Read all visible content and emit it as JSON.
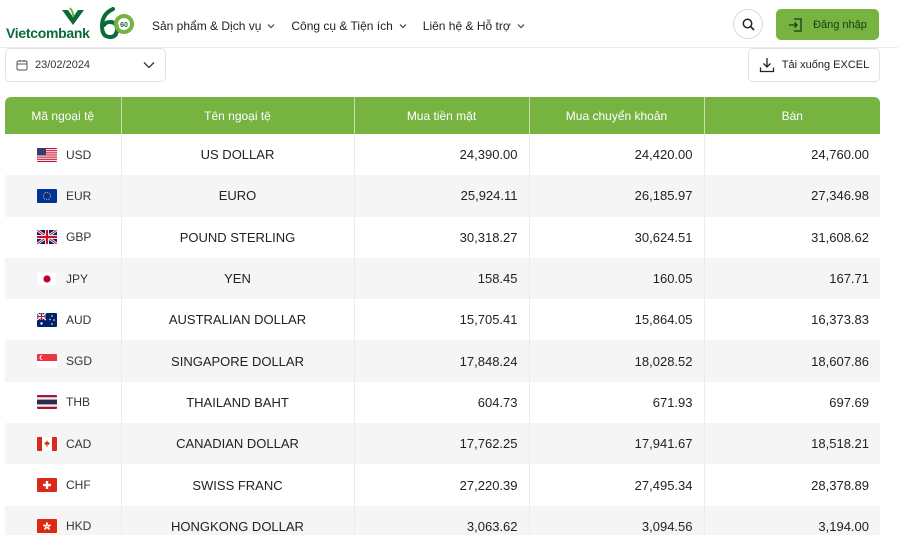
{
  "brand": {
    "name": "Vietcombank",
    "anniversary": "60"
  },
  "nav": [
    {
      "label": "Sản phẩm & Dịch vụ"
    },
    {
      "label": "Công cụ & Tiện ích"
    },
    {
      "label": "Liên hệ & Hỗ trợ"
    }
  ],
  "header": {
    "login_label": "Đăng nhập"
  },
  "toolbar": {
    "date_value": "23/02/2024",
    "excel_label": "Tải xuống EXCEL"
  },
  "colors": {
    "accent": "#77b341",
    "brand_green": "#0b6b3a"
  },
  "table": {
    "headers": [
      "Mã ngoại tệ",
      "Tên ngoại tệ",
      "Mua tiền mặt",
      "Mua chuyển khoản",
      "Bán"
    ],
    "rows": [
      {
        "code": "USD",
        "flag": "us-flag",
        "name": "US DOLLAR",
        "cash": "24,390.00",
        "transfer": "24,420.00",
        "sell": "24,760.00"
      },
      {
        "code": "EUR",
        "flag": "eu-flag",
        "name": "EURO",
        "cash": "25,924.11",
        "transfer": "26,185.97",
        "sell": "27,346.98"
      },
      {
        "code": "GBP",
        "flag": "uk-flag",
        "name": "POUND STERLING",
        "cash": "30,318.27",
        "transfer": "30,624.51",
        "sell": "31,608.62"
      },
      {
        "code": "JPY",
        "flag": "jp-flag",
        "name": "YEN",
        "cash": "158.45",
        "transfer": "160.05",
        "sell": "167.71"
      },
      {
        "code": "AUD",
        "flag": "au-flag",
        "name": "AUSTRALIAN DOLLAR",
        "cash": "15,705.41",
        "transfer": "15,864.05",
        "sell": "16,373.83"
      },
      {
        "code": "SGD",
        "flag": "sg-flag",
        "name": "SINGAPORE DOLLAR",
        "cash": "17,848.24",
        "transfer": "18,028.52",
        "sell": "18,607.86"
      },
      {
        "code": "THB",
        "flag": "th-flag",
        "name": "THAILAND BAHT",
        "cash": "604.73",
        "transfer": "671.93",
        "sell": "697.69"
      },
      {
        "code": "CAD",
        "flag": "ca-flag",
        "name": "CANADIAN DOLLAR",
        "cash": "17,762.25",
        "transfer": "17,941.67",
        "sell": "18,518.21"
      },
      {
        "code": "CHF",
        "flag": "ch-flag",
        "name": "SWISS FRANC",
        "cash": "27,220.39",
        "transfer": "27,495.34",
        "sell": "28,378.89"
      },
      {
        "code": "HKD",
        "flag": "hk-flag",
        "name": "HONGKONG DOLLAR",
        "cash": "3,063.62",
        "transfer": "3,094.56",
        "sell": "3,194.00"
      }
    ]
  }
}
